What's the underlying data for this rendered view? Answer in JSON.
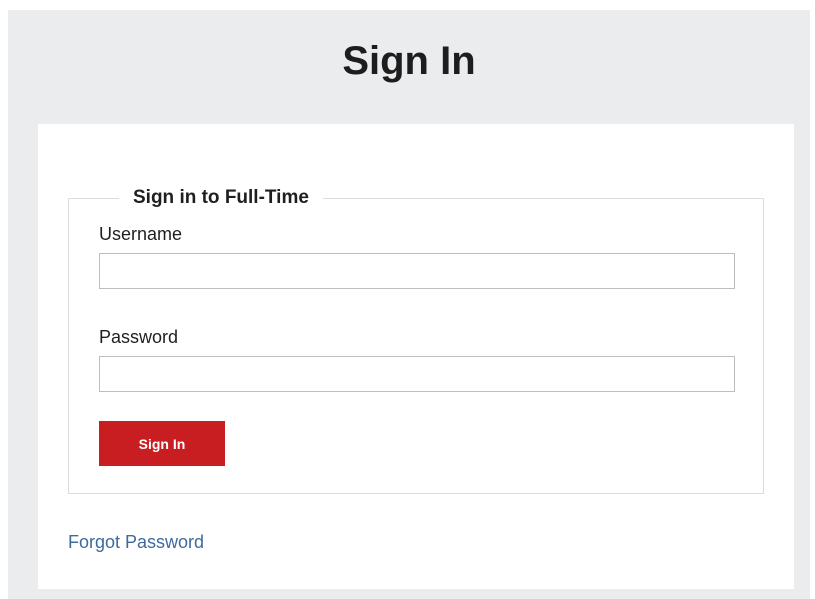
{
  "page": {
    "title": "Sign In"
  },
  "form": {
    "legend": "Sign in to Full-Time",
    "username": {
      "label": "Username",
      "value": "",
      "placeholder": ""
    },
    "password": {
      "label": "Password",
      "value": "",
      "placeholder": ""
    },
    "submit_label": "Sign In"
  },
  "links": {
    "forgot_password": "Forgot Password"
  },
  "colors": {
    "page_background": "#ebecee",
    "card_background": "#ffffff",
    "button": "#c91e21",
    "link": "#3d6b9e"
  }
}
